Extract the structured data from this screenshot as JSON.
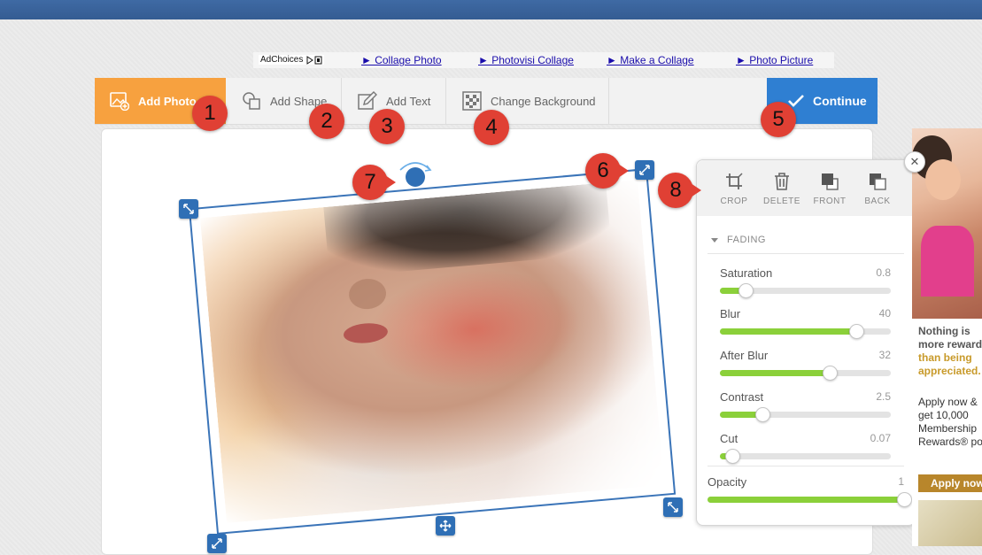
{
  "adbar": {
    "adchoices": "AdChoices",
    "links": [
      "► Collage Photo",
      "► Photovisi Collage",
      "► Make a Collage",
      "► Photo Picture"
    ]
  },
  "toolbar": {
    "add_photo": "Add Photo",
    "add_shape": "Add Shape",
    "add_text": "Add Text",
    "change_background": "Change Background",
    "continue": "Continue"
  },
  "markers": [
    "1",
    "2",
    "3",
    "4",
    "5",
    "6",
    "7",
    "8"
  ],
  "panel": {
    "tools": [
      "CROP",
      "DELETE",
      "FRONT",
      "BACK"
    ],
    "section": "FADING",
    "sliders": [
      {
        "name": "Saturation",
        "value": "0.8",
        "fraction": 0.15
      },
      {
        "name": "Blur",
        "value": "40",
        "fraction": 0.8
      },
      {
        "name": "After Blur",
        "value": "32",
        "fraction": 0.64
      },
      {
        "name": "Contrast",
        "value": "2.5",
        "fraction": 0.25
      },
      {
        "name": "Cut",
        "value": "0.07",
        "fraction": 0.07
      }
    ],
    "opacity": {
      "name": "Opacity",
      "value": "1",
      "fraction": 1.0
    }
  },
  "ad": {
    "line1": [
      "Nothing is",
      "more reward",
      "than being",
      "appreciated."
    ],
    "line2": [
      "Apply now &",
      "get 10,000",
      "Membership",
      "Rewards® poi"
    ],
    "cta": "Apply now"
  },
  "colors": {
    "accent_orange": "#f7a13f",
    "accent_blue": "#2f7fd2",
    "marker_red": "#e04034",
    "slider_green": "#8bd03a"
  }
}
